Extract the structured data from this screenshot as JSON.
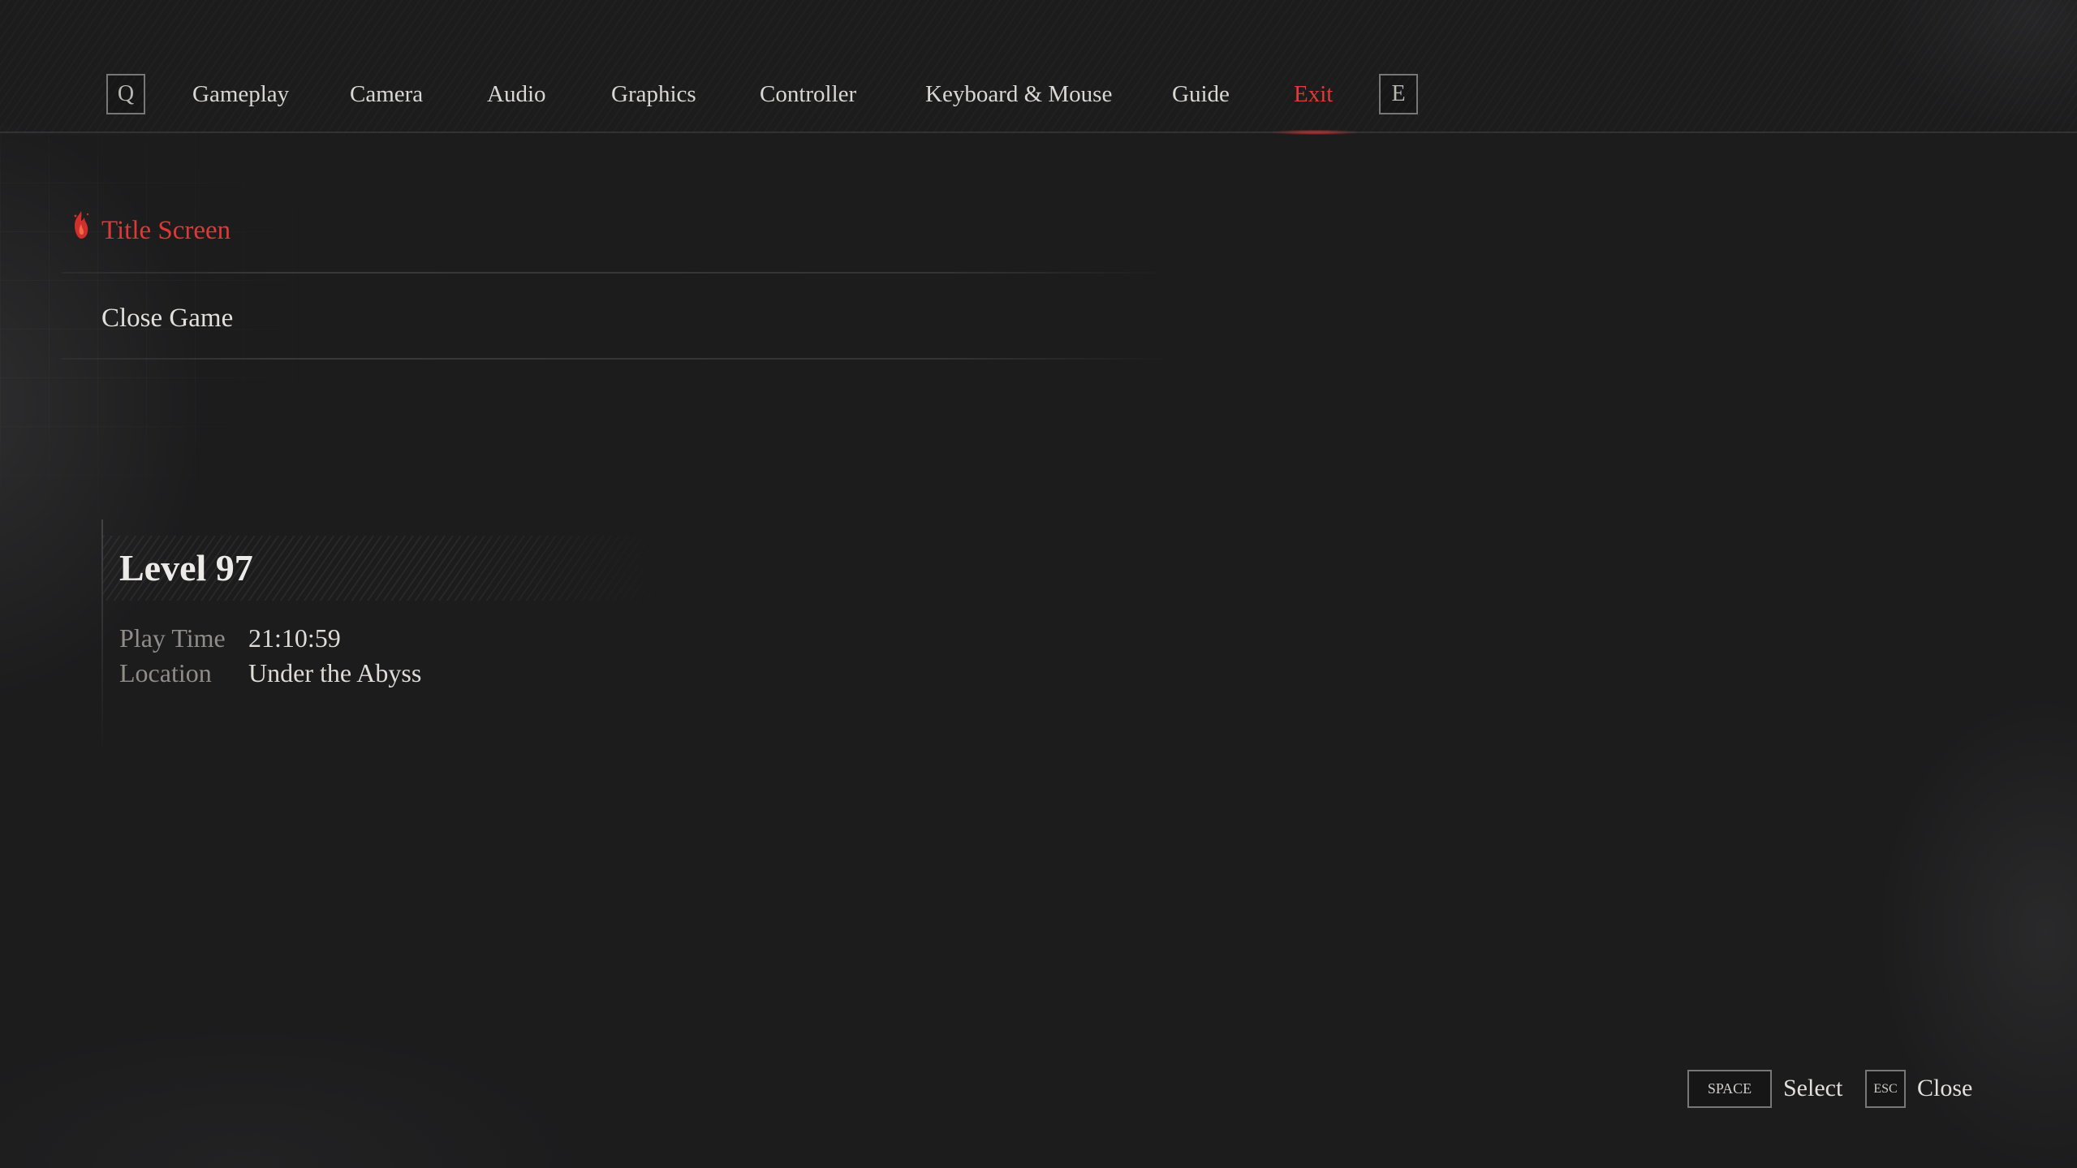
{
  "nav": {
    "prev_key": "Q",
    "next_key": "E",
    "tabs": [
      {
        "label": "Gameplay"
      },
      {
        "label": "Camera"
      },
      {
        "label": "Audio"
      },
      {
        "label": "Graphics"
      },
      {
        "label": "Controller"
      },
      {
        "label": "Keyboard & Mouse"
      },
      {
        "label": "Guide"
      },
      {
        "label": "Exit"
      }
    ],
    "active_tab": "Exit"
  },
  "menu": {
    "items": [
      {
        "label": "Title Screen",
        "selected": true
      },
      {
        "label": "Close Game",
        "selected": false
      }
    ]
  },
  "save_info": {
    "level": "Level 97",
    "play_time_label": "Play Time",
    "play_time": "21:10:59",
    "location_label": "Location",
    "location": "Under the Abyss"
  },
  "prompts": {
    "select_key": "SPACE",
    "select_label": "Select",
    "close_key": "ESC",
    "close_label": "Close"
  },
  "colors": {
    "background": "#1c1c1d",
    "accent_red": "#e03838",
    "text_primary": "#e2e0dc",
    "text_muted": "#8f8d8a"
  }
}
